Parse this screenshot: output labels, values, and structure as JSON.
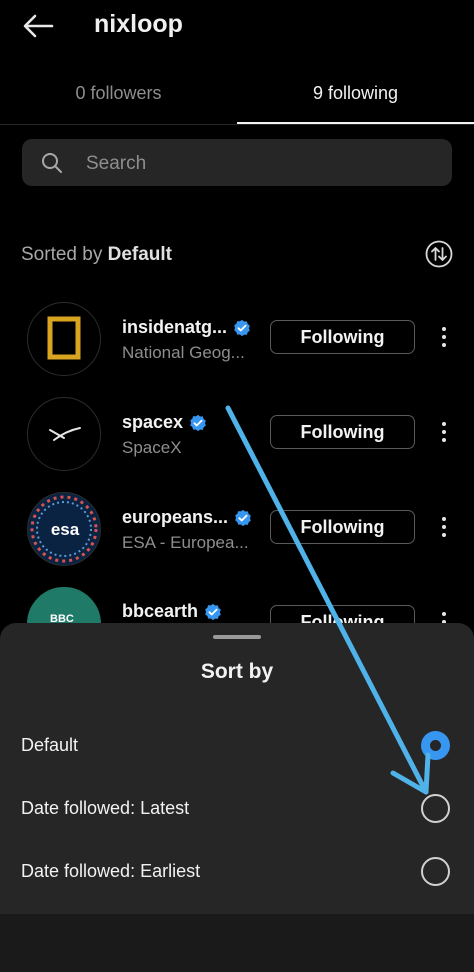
{
  "header": {
    "title": "nixloop"
  },
  "tabs": [
    {
      "label": "0 followers"
    },
    {
      "label": "9 following"
    }
  ],
  "search": {
    "placeholder": "Search"
  },
  "sort": {
    "prefix": "Sorted by",
    "value": "Default"
  },
  "accounts": [
    {
      "username": "insidenatg...",
      "full_name": "National Geog...",
      "verified": true,
      "button": "Following"
    },
    {
      "username": "spacex",
      "full_name": "SpaceX",
      "verified": true,
      "button": "Following"
    },
    {
      "username": "europeans...",
      "full_name": "ESA - Europea...",
      "verified": true,
      "button": "Following",
      "avatar_text": "esa"
    },
    {
      "username": "bbcearth",
      "full_name": "",
      "verified": true,
      "button": "Following",
      "avatar_text": "BBC"
    }
  ],
  "sheet": {
    "title": "Sort by",
    "options": [
      {
        "label": "Default",
        "selected": true
      },
      {
        "label": "Date followed: Latest",
        "selected": false
      },
      {
        "label": "Date followed: Earliest",
        "selected": false
      }
    ]
  },
  "colors": {
    "accent": "#3797f0",
    "annotation_arrow": "#4fb3ea",
    "sheet_bg": "#262626"
  }
}
